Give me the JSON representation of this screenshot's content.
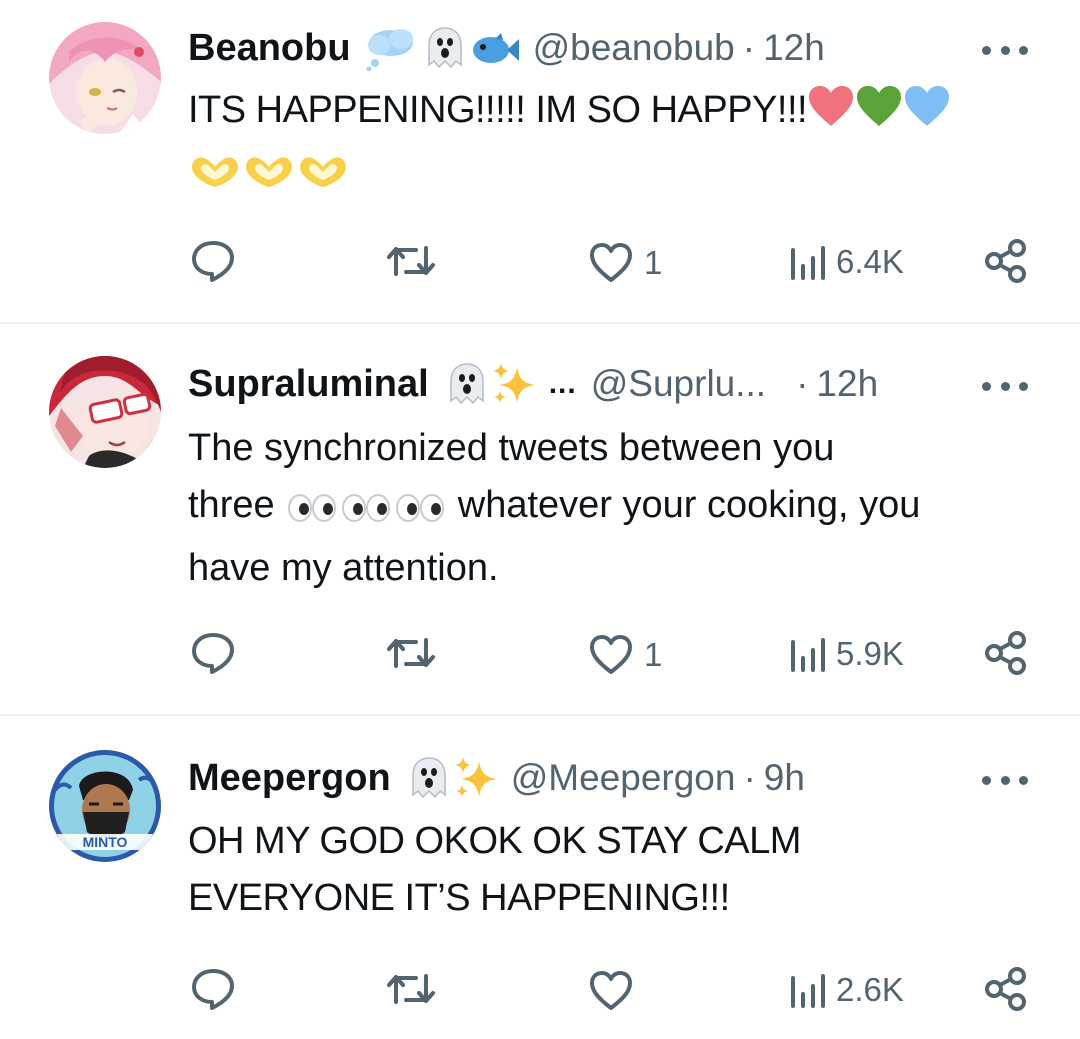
{
  "tweets": [
    {
      "display_name": "Beanobu",
      "handle": "@beanobub",
      "separator": "·",
      "time": "12h",
      "header_emojis": [
        "cloud-emoji",
        "ghost-emoji",
        "fish-emoji"
      ],
      "text_line1": "ITS HAPPENING!!!!! IM SO HAPPY!!!",
      "text_emojis_line1": [
        "red-heart-emoji",
        "green-heart-emoji",
        "blue-heart-emoji"
      ],
      "text_emojis_line2": [
        "heart-hands-emoji",
        "heart-hands-emoji",
        "heart-hands-emoji"
      ],
      "replies": "",
      "retweets": "",
      "likes": "1",
      "views": "6.4K"
    },
    {
      "display_name": "Supraluminal",
      "name_overflow": "...",
      "handle": "@Suprlu...",
      "separator": "·",
      "time": "12h",
      "header_emojis": [
        "ghost-emoji",
        "sparkles-emoji"
      ],
      "text_line1": "The synchronized tweets between you",
      "text_line2_start": "three",
      "text_line2_end": "whatever your cooking, you",
      "text_line3": "have my attention.",
      "text_emojis_line2": [
        "eyes-emoji",
        "eyes-emoji",
        "eyes-emoji"
      ],
      "replies": "",
      "retweets": "",
      "likes": "1",
      "views": "5.9K"
    },
    {
      "display_name": "Meepergon",
      "handle": "@Meepergon",
      "separator": "·",
      "time": "9h",
      "header_emojis": [
        "ghost-emoji",
        "sparkles-emoji"
      ],
      "text_line1": "OH MY GOD OKOK OK STAY CALM",
      "text_line2": "EVERYONE IT’S HAPPENING!!!",
      "avatar_text": "MINTO",
      "replies": "",
      "retweets": "",
      "likes": "",
      "views": "2.6K"
    }
  ],
  "colors": {
    "text_primary": "#0f1419",
    "text_secondary": "#536471",
    "divider": "#eff3f4",
    "red_heart": "#f0727e",
    "green_heart": "#5aa33a",
    "blue_heart": "#7fbef5",
    "yellow_heart_hands": "#f8d04a",
    "sparkles": "#f8c23a"
  }
}
